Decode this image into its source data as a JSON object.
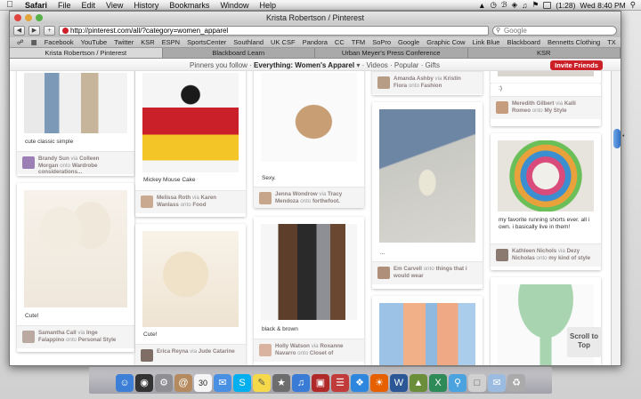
{
  "menubar": {
    "items": [
      "Safari",
      "File",
      "Edit",
      "View",
      "History",
      "Bookmarks",
      "Window",
      "Help"
    ],
    "battery": "(1:28)",
    "clock": "Wed 8:40 PM"
  },
  "window": {
    "title": "Krista Robertson / Pinterest"
  },
  "toolbar": {
    "url": "http://pinterest.com/all/?category=women_apparel",
    "search_placeholder": "Google"
  },
  "bookmarks": [
    "Facebook",
    "YouTube",
    "Twitter",
    "KSR",
    "ESPN",
    "SportsCenter",
    "Southland",
    "UK CSF",
    "Pandora",
    "CC",
    "TFM",
    "SoPro",
    "Google",
    "Graphic Cow",
    "Link Blue",
    "Blackboard",
    "Bennetts Clothing",
    "TX"
  ],
  "tabs": [
    "Krista Robertson / Pinterest",
    "Blackboard Learn",
    "Urban Meyer's Press Conference",
    "KSR"
  ],
  "pinbar": {
    "prefix": "Pinners you follow ·",
    "selected": "Everything: Women's Apparel",
    "rest": "· Videos · Popular · Gifts",
    "invite": "Invite Friends"
  },
  "pins": [
    {
      "desc": "cute classic simple",
      "user": "Brandy Sun",
      "via": "Colleen Morgan",
      "board": "Wardrobe considerations..."
    },
    {
      "desc": "Cute!",
      "user": "Samantha Call",
      "via": "Inge Falappino",
      "board": "Personal Style"
    },
    {
      "desc": "Mickey Mouse Cake",
      "user": "Melissa Roth",
      "via": "Karen Wanlass",
      "board": "Food"
    },
    {
      "desc": "Cute!",
      "user": "Erica Reyna",
      "via": "Jude Catarine",
      "board": ""
    },
    {
      "desc": "Sexy.",
      "user": "Jenna Wondrow",
      "via": "Tracy Mendoza",
      "board": "forthefoot."
    },
    {
      "desc": "black & brown",
      "user": "Holly Watson",
      "via": "Roxanne Navarro",
      "board": "Closet of"
    },
    {
      "desc": "",
      "user": "Amanda Ashby",
      "via": "Kristin Fiora",
      "board": "Fashion"
    },
    {
      "desc": "...",
      "user": "Em Carvell",
      "via": "",
      "board": "things that i would wear"
    },
    {
      "desc": ":)",
      "user": "Meredith Gilbert",
      "via": "Kalli Romeo",
      "board": "My Style"
    },
    {
      "desc": "my favorite running shorts ever. all i own. i basically live in them!",
      "user": "Kathleen Nichols",
      "via": "Dezy Nicholas",
      "board": "my kind of style"
    }
  ],
  "scroll_to_top": "Scroll to Top",
  "calendar_day": "30"
}
